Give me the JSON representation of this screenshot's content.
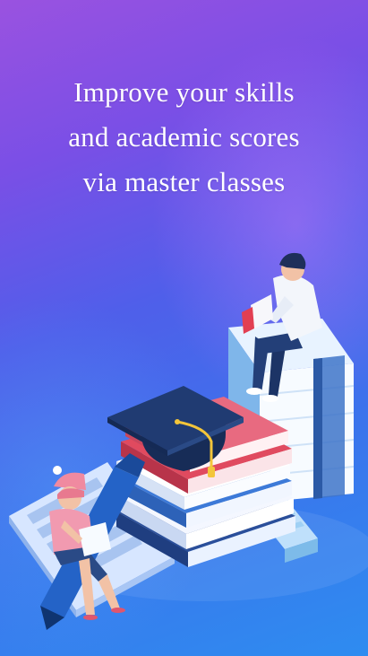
{
  "onboarding": {
    "headline_lines": [
      "Improve your skills",
      "and academic scores",
      "via master classes"
    ]
  },
  "colors": {
    "background_top": "#9a52e0",
    "background_bottom": "#2e8cf0",
    "text": "#ffffff"
  },
  "icons": [
    "graduation-cap-icon",
    "books-stack-icon",
    "keyboard-icon",
    "pen-icon"
  ]
}
